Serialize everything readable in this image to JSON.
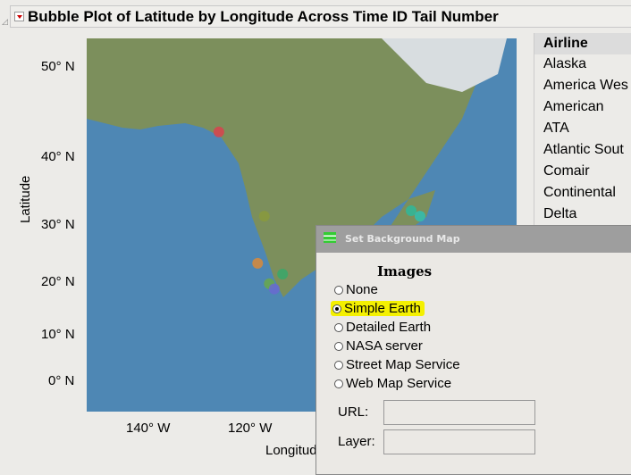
{
  "report": {
    "title": "Bubble Plot of Latitude by Longitude Across Time ID Tail Number"
  },
  "chart_data": {
    "type": "scatter",
    "subtype": "bubble",
    "background": "map (Simple Earth)",
    "xlabel": "Longitude",
    "ylabel": "Latitude",
    "xticks": [
      "140° W",
      "120° W"
    ],
    "yticks": [
      "50° N",
      "40° N",
      "30° N",
      "20° N",
      "10° N",
      "0° N"
    ],
    "points": [
      {
        "lon": -127.6,
        "lat": 42.8,
        "color": "#d9434e"
      },
      {
        "lon": -119.4,
        "lat": 31.3,
        "color": "#8a9a3c"
      },
      {
        "lon": -120.6,
        "lat": 23.3,
        "color": "#d98a3a"
      },
      {
        "lon": -116.1,
        "lat": 21.4,
        "color": "#3aa86a"
      },
      {
        "lon": -118.5,
        "lat": 19.7,
        "color": "#6aa84a"
      },
      {
        "lon": -117.6,
        "lat": 18.7,
        "color": "#6a6ad0"
      },
      {
        "lon": -92.9,
        "lat": 32.1,
        "color": "#2fb89a"
      },
      {
        "lon": -91.3,
        "lat": 31.3,
        "color": "#30c0b0"
      }
    ]
  },
  "legend": {
    "header": "Airline",
    "items": [
      "Alaska",
      "America Wes",
      "American",
      "ATA",
      "Atlantic Sout",
      "Comair",
      "Continental",
      "Delta"
    ]
  },
  "dialog": {
    "title": "Set Background Map",
    "images_label": "Images",
    "options": [
      "None",
      "Simple Earth",
      "Detailed Earth",
      "NASA server",
      "Street Map Service",
      "Web Map Service"
    ],
    "selected": "Simple Earth",
    "url_label": "URL:",
    "url_value": "",
    "layer_label": "Layer:",
    "layer_value": ""
  }
}
